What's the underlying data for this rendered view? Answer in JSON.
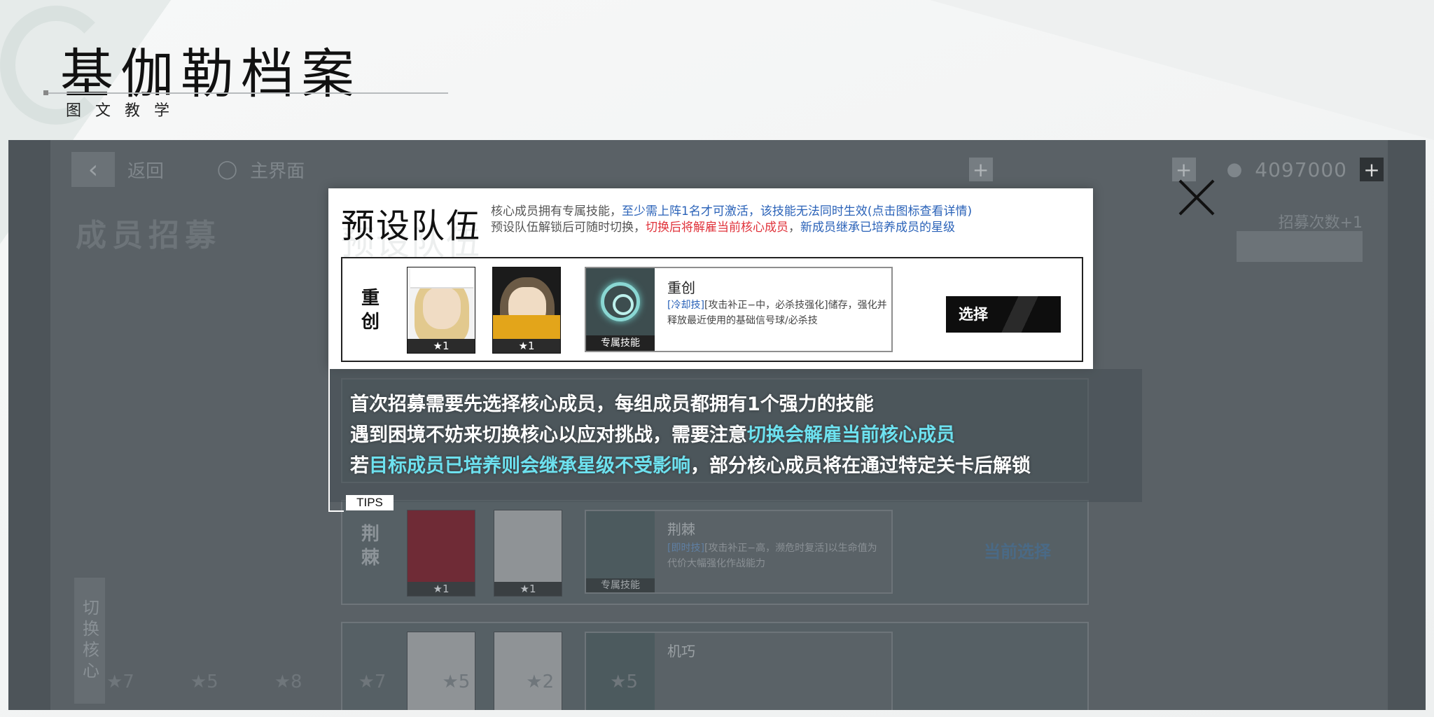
{
  "slide": {
    "title": "基伽勒档案",
    "subtitle": "图文教学"
  },
  "game": {
    "top_bar": {
      "back_label": "返回",
      "home_label": "主界面",
      "resource_value": "4097000"
    },
    "page_heading": "成员招募",
    "right_extra": "招募次数+1",
    "switch_core_label": "切换核心",
    "bottom_stars": [
      "★7",
      "★5",
      "★8",
      "★7",
      "★5",
      "★2",
      "★5"
    ]
  },
  "modal": {
    "title": "预设队伍",
    "info_line1_prefix": "核心成员拥有专属技能，",
    "info_line1_blue": "至少需上阵1名才可激活，该技能无法同时生效(点击图标查看详情)",
    "info_line2_prefix": "预设队伍解锁后可随时切换，",
    "info_line2_red": "切换后将解雇当前核心成员",
    "info_line2_sep": "，",
    "info_line2_blue": "新成员继承已培养成员的星级",
    "team": {
      "label": "重创",
      "member_stars": [
        "★1",
        "★1"
      ],
      "skill_badge": "专属技能",
      "skill_name": "重创",
      "skill_tag": "[冷却技]",
      "skill_desc": "[攻击补正−中，必杀技强化]储存，强化并释放最近使用的基础信号球/必杀技",
      "select_label": "选择"
    }
  },
  "rows": [
    {
      "label": "荆棘",
      "member_stars": [
        "★1",
        "★1"
      ],
      "skill_badge": "专属技能",
      "skill_name": "荆棘",
      "skill_tag": "[即时技]",
      "skill_desc": "[攻击补正−高，濒危时复活]以生命值为代价大幅强化作战能力",
      "status": "当前选择"
    },
    {
      "label": "",
      "skill_name": "机巧"
    }
  ],
  "tips": {
    "tag": "TIPS",
    "line1": "首次招募需要先选择核心成员，每组成员都拥有1个强力的技能",
    "line2_prefix": "遇到困境不妨来切换核心以应对挑战，需要注意",
    "line2_hl": "切换会解雇当前核心成员",
    "line3_prefix": "若",
    "line3_hl": "目标成员已培养则会继承星级不受影响",
    "line3_suffix": "，部分核心成员将在通过特定关卡后解锁"
  },
  "colors": {
    "highlight_cyan": "#6de1ef",
    "info_blue": "#2a62b8",
    "info_red": "#e0333b"
  }
}
